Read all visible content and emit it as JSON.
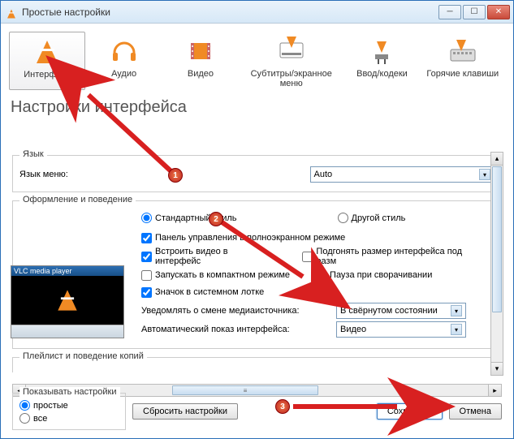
{
  "titlebar": {
    "title": "Простые настройки"
  },
  "tabs": {
    "interface": "Интерфейс",
    "audio": "Аудио",
    "video": "Видео",
    "subtitles": "Субтитры/экранное меню",
    "input": "Ввод/кодеки",
    "hotkeys": "Горячие клавиши"
  },
  "heading": "Настройки интерфейса",
  "language": {
    "group": "Язык",
    "menu_label": "Язык меню:",
    "value": "Auto"
  },
  "look": {
    "group": "Оформление и поведение",
    "style_default": "Стандартный стиль",
    "style_other": "Другой стиль",
    "controls_fullscreen": "Панель управления в полноэкранном режиме",
    "embed_video": "Встроить видео в интерфейс",
    "fit_size": "Подгонять размер интерфейса под разм",
    "compact_mode": "Запускать в компактном режиме",
    "pause_minimize": "Пауза при сворачивании",
    "tray_icon": "Значок в системном лотке",
    "notify_media_label": "Уведомлять о смене медиаисточника:",
    "notify_media_value": "В свёрнутом состоянии",
    "auto_show_label": "Автоматический показ интерфейса:",
    "auto_show_value": "Видео"
  },
  "playlist_group": "Плейлист и поведение копий",
  "show_settings": {
    "label": "Показывать настройки",
    "simple": "простые",
    "all": "все"
  },
  "buttons": {
    "reset": "Сбросить настройки",
    "save": "Сохранить",
    "cancel": "Отмена"
  },
  "badges": {
    "b1": "1",
    "b2": "2",
    "b3": "3"
  },
  "thumb_caption": "VLC media player"
}
